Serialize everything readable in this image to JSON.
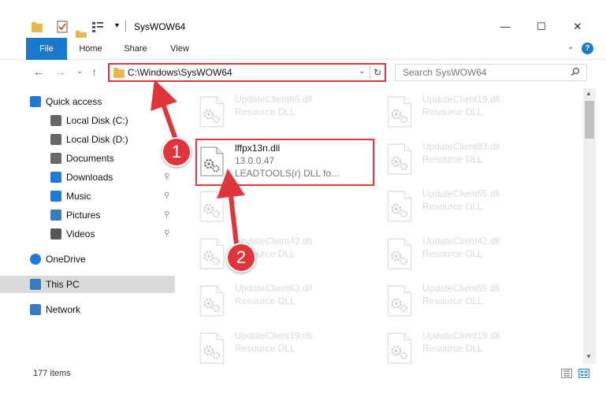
{
  "window": {
    "title": "SysWOW64",
    "minimize_glyph": "—",
    "maximize_glyph": "☐",
    "close_glyph": "✕"
  },
  "ribbon": {
    "tabs": [
      {
        "label": "File",
        "active": true
      },
      {
        "label": "Home",
        "active": false
      },
      {
        "label": "Share",
        "active": false
      },
      {
        "label": "View",
        "active": false
      }
    ],
    "help_label": "?",
    "expand_glyph": "⌄"
  },
  "navigation": {
    "back_glyph": "←",
    "forward_glyph": "→",
    "recent_glyph": "⌄",
    "up_glyph": "↑"
  },
  "address_bar": {
    "path": "C:\\Windows\\SysWOW64",
    "dropdown_glyph": "⌄",
    "refresh_glyph": "↻"
  },
  "search": {
    "placeholder": "Search SysWOW64"
  },
  "nav_pane": {
    "items": [
      {
        "label": "Quick access",
        "icon": "star-icon",
        "pinned": false
      },
      {
        "label": "Local Disk (C:)",
        "icon": "drive-icon",
        "pinned": false
      },
      {
        "label": "Local Disk (D:)",
        "icon": "drive-icon",
        "pinned": false
      },
      {
        "label": "Documents",
        "icon": "documents-icon",
        "pinned": true
      },
      {
        "label": "Downloads",
        "icon": "download-icon",
        "pinned": true
      },
      {
        "label": "Music",
        "icon": "music-icon",
        "pinned": true
      },
      {
        "label": "Pictures",
        "icon": "pictures-icon",
        "pinned": true
      },
      {
        "label": "Videos",
        "icon": "videos-icon",
        "pinned": true
      },
      {
        "label": "OneDrive",
        "icon": "cloud-icon",
        "pinned": false
      },
      {
        "label": "This PC",
        "icon": "computer-icon",
        "pinned": false,
        "selected": true
      },
      {
        "label": "Network",
        "icon": "network-icon",
        "pinned": false
      }
    ],
    "pin_glyph": "📌"
  },
  "files": {
    "left_column": [
      {
        "name": "UpdateClient65.dll",
        "type": "Resource DLL",
        "faded": true
      },
      {
        "name": "lffpx13n.dll",
        "type": "13.0.0.47",
        "description": "LEADTOOLS(r) DLL fo...",
        "faded": false,
        "highlighted": true
      },
      {
        "name": "",
        "type": "",
        "faded": true
      },
      {
        "name": "UpdateClient42.dll",
        "type": "Resource DLL",
        "faded": true
      },
      {
        "name": "UpdateClient63.dll",
        "type": "Resource DLL",
        "faded": true
      },
      {
        "name": "UpdateClient19.dll",
        "type": "Resource DLL",
        "faded": true
      }
    ],
    "right_column": [
      {
        "name": "UpdateClient19.dll",
        "type": "Resource DLL",
        "faded": true
      },
      {
        "name": "UpdateClient63.dll",
        "type": "Resource DLL",
        "faded": true
      },
      {
        "name": "UpdateClient65.dll",
        "type": "Resource DLL",
        "faded": true
      },
      {
        "name": "UpdateClient42.dll",
        "type": "Resource DLL",
        "faded": true
      },
      {
        "name": "UpdateClient65.dll",
        "type": "Resource DLL",
        "faded": true
      },
      {
        "name": "UpdateClient19.dll",
        "type": "Resource DLL",
        "faded": true
      }
    ]
  },
  "status": {
    "item_count": "177 items"
  },
  "annotations": {
    "step1": "1",
    "step2": "2",
    "color": "#e0353a"
  }
}
